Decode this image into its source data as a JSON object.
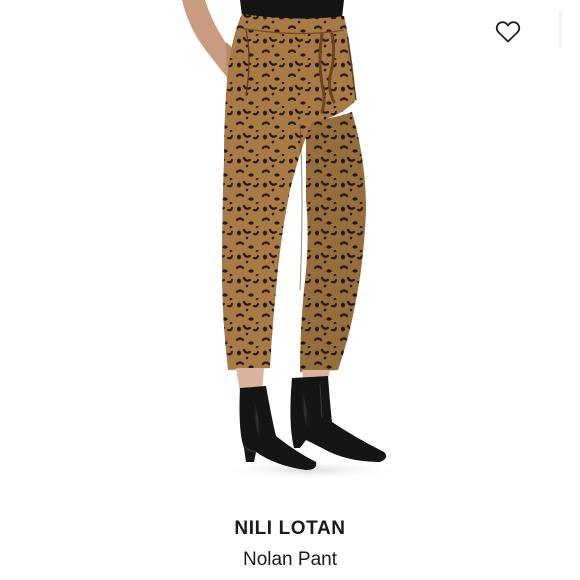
{
  "product": {
    "brand": "NILI LOTAN",
    "name": "Nolan Pant",
    "image_icon": "product-photo-leopard-print-pants",
    "wishlist_icon": "heart-outline-icon"
  },
  "colors": {
    "print_base": "#a87a45",
    "print_spot": "#231710",
    "boot": "#151515",
    "text": "#1a1a1a"
  }
}
